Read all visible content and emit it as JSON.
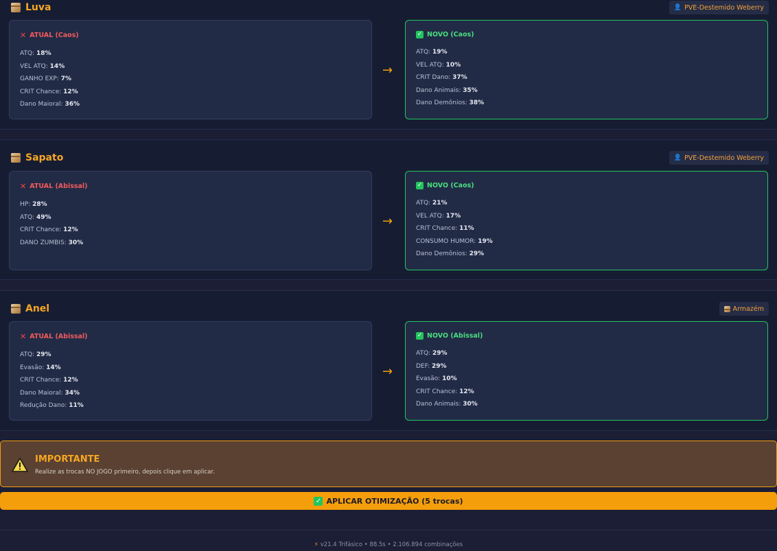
{
  "sections": [
    {
      "title": "Luva",
      "badge": "PVE-Destemido Weberry",
      "badge_icon": "person-icon",
      "old": {
        "label": "ATUAL (Caos)",
        "stats": [
          {
            "name": "ATQ:",
            "value": "18%"
          },
          {
            "name": "VEL ATQ:",
            "value": "14%"
          },
          {
            "name": "GANHO EXP:",
            "value": "7%"
          },
          {
            "name": "CRIT Chance:",
            "value": "12%"
          },
          {
            "name": "Dano Maioral:",
            "value": "36%"
          }
        ]
      },
      "new": {
        "label": "NOVO (Caos)",
        "stats": [
          {
            "name": "ATQ:",
            "value": "19%"
          },
          {
            "name": "VEL ATQ:",
            "value": "10%"
          },
          {
            "name": "CRIT Dano:",
            "value": "37%"
          },
          {
            "name": "Dano Animais:",
            "value": "35%"
          },
          {
            "name": "Dano Demônios:",
            "value": "38%"
          }
        ]
      }
    },
    {
      "title": "Sapato",
      "badge": "PVE-Destemido Weberry",
      "badge_icon": "person-icon",
      "old": {
        "label": "ATUAL (Abissal)",
        "stats": [
          {
            "name": "HP:",
            "value": "28%"
          },
          {
            "name": "ATQ:",
            "value": "49%"
          },
          {
            "name": "CRIT Chance:",
            "value": "12%"
          },
          {
            "name": "DANO ZUMBIS:",
            "value": "30%"
          }
        ]
      },
      "new": {
        "label": "NOVO (Caos)",
        "stats": [
          {
            "name": "ATQ:",
            "value": "21%"
          },
          {
            "name": "VEL ATQ:",
            "value": "17%"
          },
          {
            "name": "CRIT Chance:",
            "value": "11%"
          },
          {
            "name": "CONSUMO HUMOR:",
            "value": "19%"
          },
          {
            "name": "Dano Demônios:",
            "value": "29%"
          }
        ]
      }
    },
    {
      "title": "Anel",
      "badge": "Armazém",
      "badge_icon": "box-icon",
      "old": {
        "label": "ATUAL (Abissal)",
        "stats": [
          {
            "name": "ATQ:",
            "value": "29%"
          },
          {
            "name": "Evasão:",
            "value": "14%"
          },
          {
            "name": "CRIT Chance:",
            "value": "12%"
          },
          {
            "name": "Dano Maioral:",
            "value": "34%"
          },
          {
            "name": "Redução Dano:",
            "value": "11%"
          }
        ]
      },
      "new": {
        "label": "NOVO (Abissal)",
        "stats": [
          {
            "name": "ATQ:",
            "value": "29%"
          },
          {
            "name": "DEF:",
            "value": "29%"
          },
          {
            "name": "Evasão:",
            "value": "10%"
          },
          {
            "name": "CRIT Chance:",
            "value": "12%"
          },
          {
            "name": "Dano Animais:",
            "value": "30%"
          }
        ]
      }
    }
  ],
  "arrow": "→",
  "important": {
    "title": "IMPORTANTE",
    "text": "Realize as trocas NO JOGO primeiro, depois clique em aplicar."
  },
  "apply_button": {
    "label": "APLICAR OTIMIZAÇÃO (5 trocas)"
  },
  "footer": {
    "text": "v21.4 Trifásico • 88.5s • 2.106.894 combinações"
  },
  "colors": {
    "accent": "#f59e0b",
    "success": "#22c55e",
    "danger": "#ef4444",
    "panel": "#222b46",
    "background": "#161d33"
  }
}
